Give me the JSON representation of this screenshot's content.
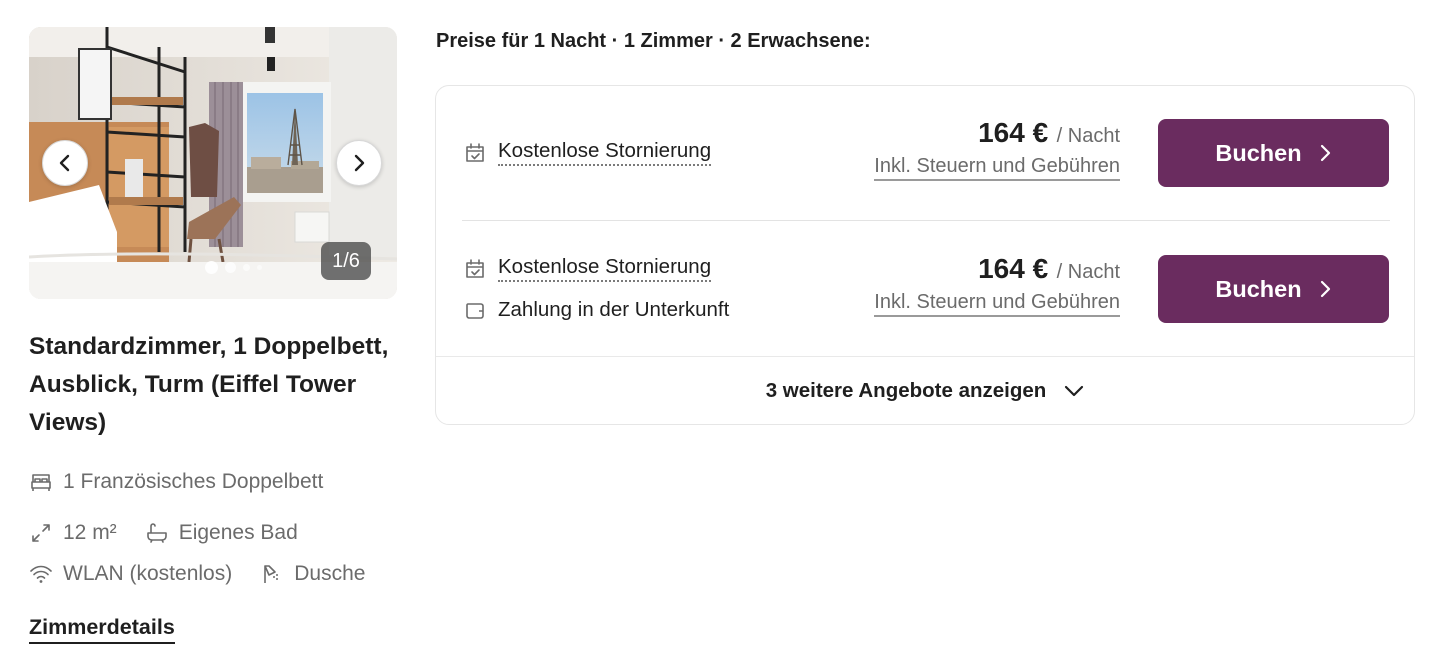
{
  "room": {
    "gallery": {
      "counter": "1/6",
      "prev_label": "prev",
      "next_label": "next",
      "active_index": 1,
      "total": 6
    },
    "title": "Standardzimmer, 1 Doppelbett, Ausblick, Turm (Eiffel Tower Views)",
    "features": {
      "bed": "1 Französisches Doppelbett",
      "size": "12 m²",
      "bath": "Eigenes Bad",
      "wifi": "WLAN (kostenlos)",
      "shower": "Dusche"
    },
    "details_link": "Zimmerdetails"
  },
  "prices_header": "Preise für 1 Nacht · 1 Zimmer · 2 Erwachsene:",
  "offers": [
    {
      "conditions": [
        "Kostenlose Stornierung"
      ],
      "price": "164 €",
      "per": "/ Nacht",
      "taxes": "Inkl. Steuern und Gebühren",
      "button": "Buchen"
    },
    {
      "conditions": [
        "Kostenlose Stornierung",
        "Zahlung in der Unterkunft"
      ],
      "price": "164 €",
      "per": "/ Nacht",
      "taxes": "Inkl. Steuern und Gebühren",
      "button": "Buchen"
    }
  ],
  "more_offers": "3 weitere Angebote anzeigen",
  "colors": {
    "accent": "#6a2c5f",
    "text": "#1f1f1f",
    "muted": "#6b6b6b",
    "border": "#e6e6e6"
  },
  "icons": {
    "bed": "bed-icon",
    "size": "expand-arrows-icon",
    "bath": "bathtub-icon",
    "wifi": "wifi-icon",
    "shower": "shower-icon",
    "cancel": "calendar-check-icon",
    "wallet": "wallet-icon",
    "chevron": "chevron-right-icon",
    "expand": "chevron-down-icon"
  }
}
